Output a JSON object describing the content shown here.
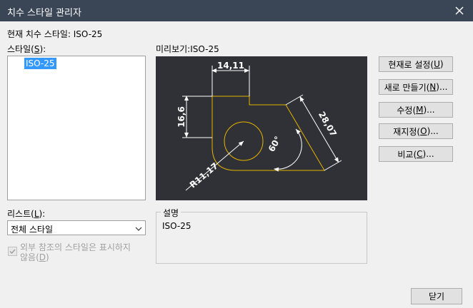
{
  "window": {
    "title": "치수 스타일 관리자"
  },
  "current_style": {
    "label": "현재 치수 스타일: ISO-25"
  },
  "styles": {
    "label_prefix": "스타일(",
    "label_key": "S",
    "label_suffix": "):",
    "items": [
      {
        "label": "ISO-25",
        "selected": true
      }
    ]
  },
  "preview": {
    "label": "미리보기:ISO-25",
    "dimensions": {
      "top_width": "14,11",
      "left_height": "16,6",
      "slanted": "28,07",
      "angle": "60°",
      "radius": "R11,17"
    },
    "colors": {
      "background": "#2f3136",
      "geometry": "#e6b400",
      "dimension": "#ffffff"
    }
  },
  "buttons": {
    "set_current": {
      "text": "현재로 설정(",
      "key": "U",
      "suffix": ")"
    },
    "new": {
      "text": "새로 만들기(",
      "key": "N",
      "suffix": ")..."
    },
    "modify": {
      "text": "수정(",
      "key": "M",
      "suffix": ")..."
    },
    "override": {
      "text": "재지정(",
      "key": "O",
      "suffix": ")..."
    },
    "compare": {
      "text": "비교(",
      "key": "C",
      "suffix": ")..."
    },
    "close": {
      "text": "닫기"
    }
  },
  "list_filter": {
    "label_prefix": "리스트(",
    "label_key": "L",
    "label_suffix": "):",
    "selected": "전체 스타일"
  },
  "xref_checkbox": {
    "line1": "외부 참조의 스타일은 표시하지",
    "line2_prefix": "않음(",
    "line2_key": "D",
    "line2_suffix": ")",
    "checked": true,
    "enabled": false
  },
  "description": {
    "legend": "설명",
    "text": "ISO-25"
  }
}
